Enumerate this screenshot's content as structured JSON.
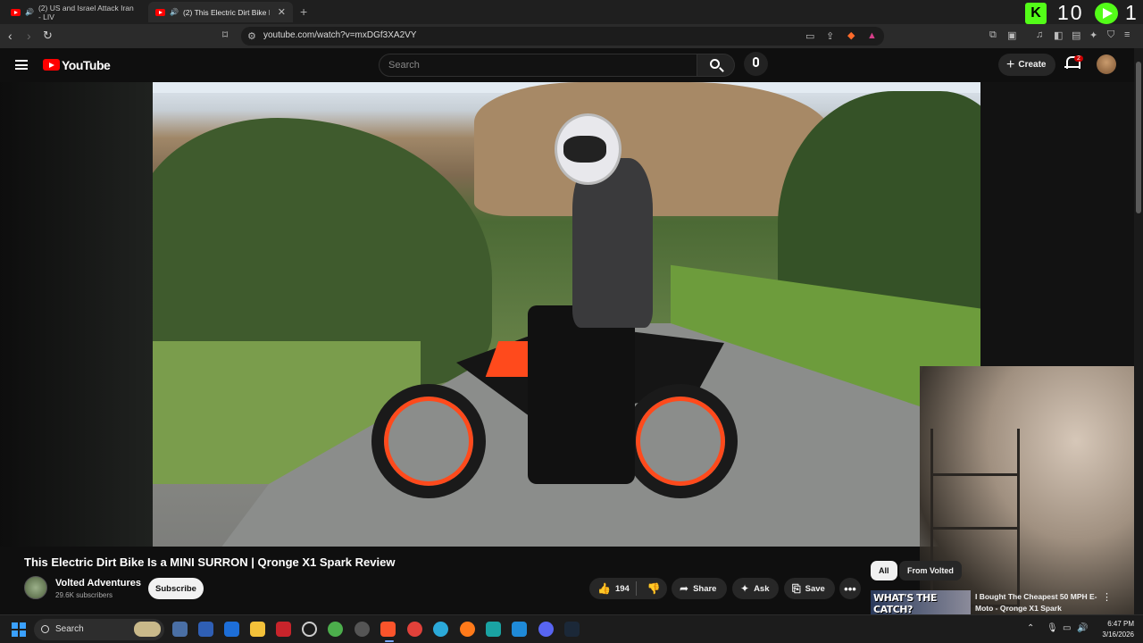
{
  "browser": {
    "tabs": [
      {
        "label": "(2) US and Israel Attack Iran - LIV",
        "active": false
      },
      {
        "label": "(2) This Electric Dirt Bike Is a I",
        "active": true
      }
    ],
    "new_tab": "+",
    "url": "youtube.com/watch?v=mxDGf3XA2VY",
    "kick_count": "10",
    "kick_letter": "K",
    "play_count": "1"
  },
  "youtube": {
    "logo_text": "YouTube",
    "search_placeholder": "Search",
    "create_label": "Create",
    "notification_count": "2"
  },
  "video": {
    "title": "This Electric Dirt Bike Is a MINI SURRON | Qronge X1 Spark Review",
    "channel_name": "Volted Adventures",
    "subscribers": "29.6K subscribers",
    "subscribe_label": "Subscribe",
    "like_count": "194",
    "share_label": "Share",
    "ask_label": "Ask",
    "save_label": "Save",
    "more_label": "•••"
  },
  "sidebar": {
    "chips": [
      "All",
      "From Volted"
    ],
    "rec_thumb_text": "WHAT'S THE CATCH?",
    "rec_title": "I Bought The Cheapest 50 MPH E-Moto - Qronge X1 Spark",
    "rec_more": "⋮"
  },
  "taskbar": {
    "search_label": "Search",
    "time": "6:47 PM",
    "date": "3/16/2026"
  },
  "colors": {
    "accent_red": "#ff0000",
    "kick_green": "#53fc18",
    "rim_orange": "#ff4a1c"
  }
}
